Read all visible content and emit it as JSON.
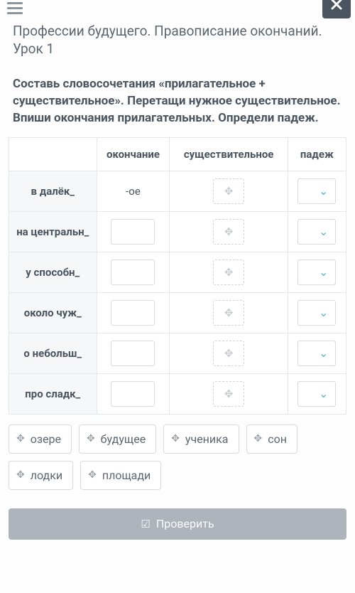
{
  "header": {
    "title": "Профессии будущего. Правописание окончаний. Урок 1"
  },
  "instruction": "Составь словосочетания «прилагательное + существительное». Перетащи нужное существительное. Впиши окончания прилагательных. Определи падеж.",
  "table": {
    "headers": {
      "c1": "",
      "c2": "окончание",
      "c3": "существительное",
      "c4": "падеж"
    },
    "rows": [
      {
        "label": "в далёк_",
        "ending": "-ое",
        "ending_is_text": true
      },
      {
        "label": "на центральн_",
        "ending": "",
        "ending_is_text": false
      },
      {
        "label": "у способн_",
        "ending": "",
        "ending_is_text": false
      },
      {
        "label": "около чуж_",
        "ending": "",
        "ending_is_text": false
      },
      {
        "label": "о небольш_",
        "ending": "",
        "ending_is_text": false
      },
      {
        "label": "про сладк_",
        "ending": "",
        "ending_is_text": false
      }
    ]
  },
  "word_bank": [
    "озере",
    "будущее",
    "ученика",
    "сон",
    "лодки",
    "площади"
  ],
  "submit_label": "Проверить"
}
